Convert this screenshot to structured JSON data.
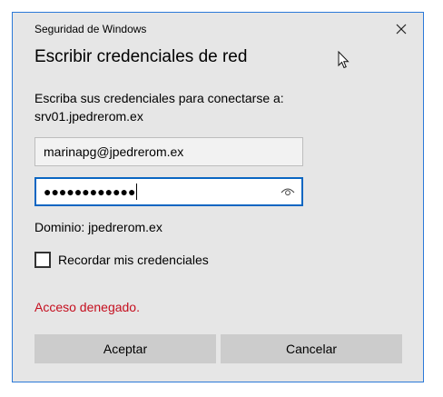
{
  "window": {
    "title": "Seguridad de Windows"
  },
  "dialog": {
    "heading": "Escribir credenciales de red",
    "prompt_line1": "Escriba sus credenciales para conectarse a:",
    "prompt_line2": "srv01.jpedrerom.ex",
    "username_value": "marinapg@jpedrerom.ex",
    "password_masked": "●●●●●●●●●●●●",
    "domain_text": "Dominio: jpedrerom.ex",
    "remember_label": "Recordar mis credenciales",
    "remember_checked": false,
    "error_text": "Acceso denegado.",
    "ok_label": "Aceptar",
    "cancel_label": "Cancelar"
  },
  "icons": {
    "close": "close-icon",
    "reveal": "eye-icon",
    "pointer": "mouse-cursor-icon"
  },
  "colors": {
    "border_accent": "#2b79d8",
    "focus": "#0a66c2",
    "error": "#c50f1f",
    "dialog_bg": "#e6e6e6",
    "button_bg": "#cccccc"
  }
}
